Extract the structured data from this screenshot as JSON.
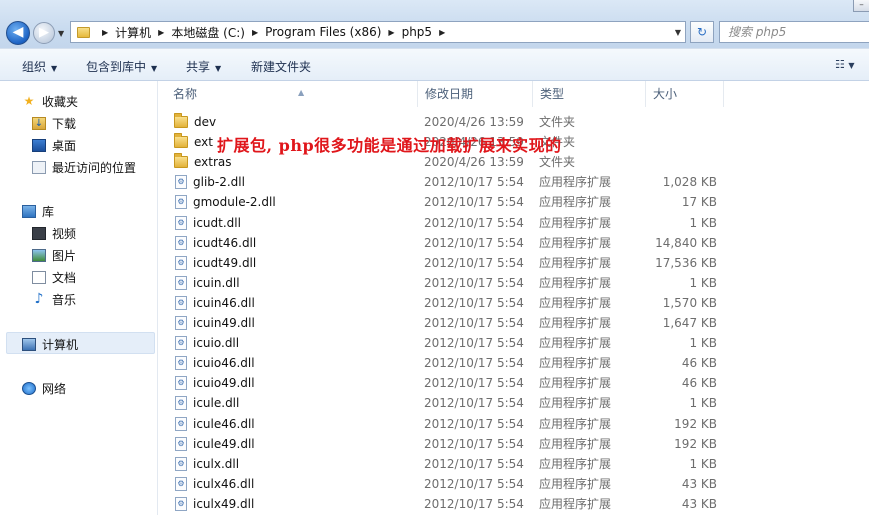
{
  "window": {
    "minimize_glyph": "–"
  },
  "addressbar": {
    "back_icon": "arrow-left-icon",
    "forward_icon": "arrow-right-icon",
    "breadcrumbs": [
      "计算机",
      "本地磁盘 (C:)",
      "Program Files (x86)",
      "php5"
    ],
    "refresh_glyph": "↻",
    "search_placeholder": "搜索 php5"
  },
  "toolbar": {
    "organize": "组织",
    "include_in_library": "包含到库中",
    "share": "共享",
    "new_folder": "新建文件夹",
    "view_glyph": "☷"
  },
  "navpane": {
    "favorites": "收藏夹",
    "downloads": "下载",
    "desktop": "桌面",
    "recent": "最近访问的位置",
    "libraries": "库",
    "videos": "视频",
    "pictures": "图片",
    "documents": "文档",
    "music": "音乐",
    "computer": "计算机",
    "network": "网络"
  },
  "columns": {
    "name": "名称",
    "date": "修改日期",
    "type": "类型",
    "size": "大小"
  },
  "files": [
    {
      "name": "dev",
      "date": "2020/4/26 13:59",
      "type": "文件夹",
      "size": "",
      "icon": "folder-icon"
    },
    {
      "name": "ext",
      "date": "2020/4/26 13:59",
      "type": "文件夹",
      "size": "",
      "icon": "folder-icon"
    },
    {
      "name": "extras",
      "date": "2020/4/26 13:59",
      "type": "文件夹",
      "size": "",
      "icon": "folder-icon"
    },
    {
      "name": "glib-2.dll",
      "date": "2012/10/17 5:54",
      "type": "应用程序扩展",
      "size": "1,028 KB",
      "icon": "dll-icon"
    },
    {
      "name": "gmodule-2.dll",
      "date": "2012/10/17 5:54",
      "type": "应用程序扩展",
      "size": "17 KB",
      "icon": "dll-icon"
    },
    {
      "name": "icudt.dll",
      "date": "2012/10/17 5:54",
      "type": "应用程序扩展",
      "size": "1 KB",
      "icon": "dll-icon"
    },
    {
      "name": "icudt46.dll",
      "date": "2012/10/17 5:54",
      "type": "应用程序扩展",
      "size": "14,840 KB",
      "icon": "dll-icon"
    },
    {
      "name": "icudt49.dll",
      "date": "2012/10/17 5:54",
      "type": "应用程序扩展",
      "size": "17,536 KB",
      "icon": "dll-icon"
    },
    {
      "name": "icuin.dll",
      "date": "2012/10/17 5:54",
      "type": "应用程序扩展",
      "size": "1 KB",
      "icon": "dll-icon"
    },
    {
      "name": "icuin46.dll",
      "date": "2012/10/17 5:54",
      "type": "应用程序扩展",
      "size": "1,570 KB",
      "icon": "dll-icon"
    },
    {
      "name": "icuin49.dll",
      "date": "2012/10/17 5:54",
      "type": "应用程序扩展",
      "size": "1,647 KB",
      "icon": "dll-icon"
    },
    {
      "name": "icuio.dll",
      "date": "2012/10/17 5:54",
      "type": "应用程序扩展",
      "size": "1 KB",
      "icon": "dll-icon"
    },
    {
      "name": "icuio46.dll",
      "date": "2012/10/17 5:54",
      "type": "应用程序扩展",
      "size": "46 KB",
      "icon": "dll-icon"
    },
    {
      "name": "icuio49.dll",
      "date": "2012/10/17 5:54",
      "type": "应用程序扩展",
      "size": "46 KB",
      "icon": "dll-icon"
    },
    {
      "name": "icule.dll",
      "date": "2012/10/17 5:54",
      "type": "应用程序扩展",
      "size": "1 KB",
      "icon": "dll-icon"
    },
    {
      "name": "icule46.dll",
      "date": "2012/10/17 5:54",
      "type": "应用程序扩展",
      "size": "192 KB",
      "icon": "dll-icon"
    },
    {
      "name": "icule49.dll",
      "date": "2012/10/17 5:54",
      "type": "应用程序扩展",
      "size": "192 KB",
      "icon": "dll-icon"
    },
    {
      "name": "iculx.dll",
      "date": "2012/10/17 5:54",
      "type": "应用程序扩展",
      "size": "1 KB",
      "icon": "dll-icon"
    },
    {
      "name": "iculx46.dll",
      "date": "2012/10/17 5:54",
      "type": "应用程序扩展",
      "size": "43 KB",
      "icon": "dll-icon"
    },
    {
      "name": "iculx49.dll",
      "date": "2012/10/17 5:54",
      "type": "应用程序扩展",
      "size": "43 KB",
      "icon": "dll-icon"
    }
  ],
  "annotation": "扩展包, php很多功能是通过加载扩展来实现的"
}
